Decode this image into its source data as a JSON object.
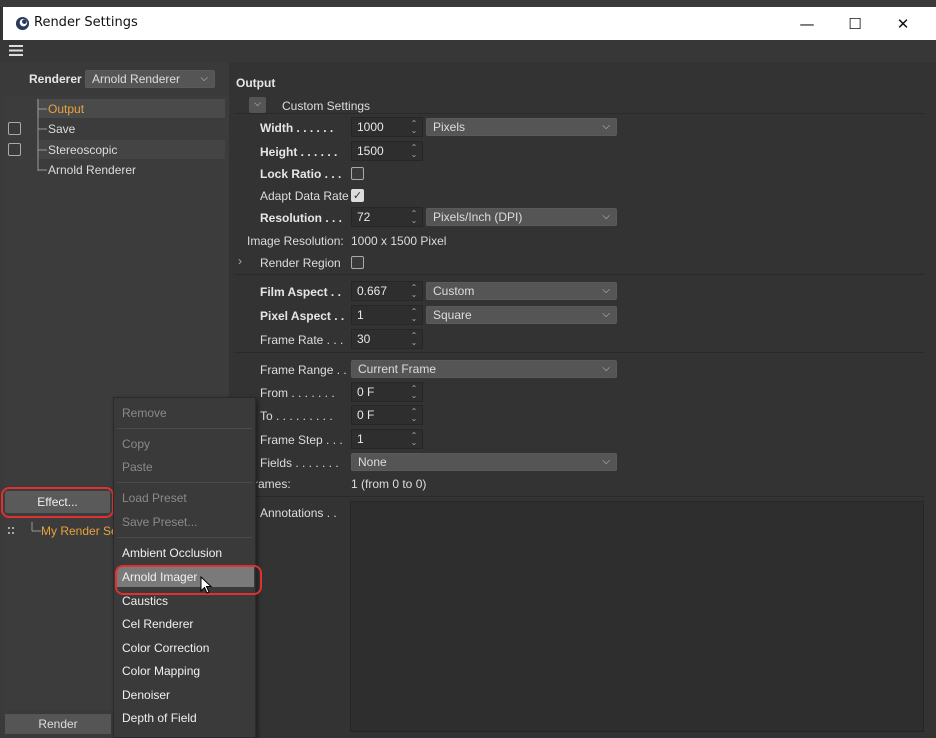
{
  "window": {
    "title": "Render Settings",
    "minimize": "—",
    "maximize": "☐",
    "close": "✕"
  },
  "left": {
    "renderer_label": "Renderer",
    "renderer_value": "Arnold Renderer",
    "tree": [
      "Output",
      "Save",
      "Stereoscopic",
      "Arnold Renderer"
    ],
    "effect_button": "Effect...",
    "my_render_setting": "My Render Se",
    "render_button": "Render"
  },
  "output": {
    "heading": "Output",
    "custom_settings": "Custom Settings",
    "width_label": "Width . . . . . .",
    "width_value": "1000",
    "width_unit": "Pixels",
    "height_label": "Height . . . . . .",
    "height_value": "1500",
    "lock_ratio_label": "Lock Ratio . . .",
    "adapt_label": "Adapt Data Rate",
    "resolution_label": "Resolution . . .",
    "resolution_value": "72",
    "resolution_unit": "Pixels/Inch (DPI)",
    "image_res_label": "Image Resolution:",
    "image_res_value": "1000 x 1500 Pixel",
    "render_region_label": "Render Region",
    "film_aspect_label": "Film Aspect . .",
    "film_aspect_value": "0.667",
    "film_aspect_preset": "Custom",
    "pixel_aspect_label": "Pixel Aspect . .",
    "pixel_aspect_value": "1",
    "pixel_aspect_preset": "Square",
    "frame_rate_label": "Frame Rate . . .",
    "frame_rate_value": "30",
    "frame_range_label": "Frame Range . .",
    "frame_range_value": "Current Frame",
    "from_label": "From . . . . . . .",
    "from_value": "0 F",
    "to_label": "To . . . . . . . . .",
    "to_value": "0 F",
    "frame_step_label": "Frame Step . . .",
    "frame_step_value": "1",
    "fields_label": "Fields . . . . . . .",
    "fields_value": "None",
    "frames_label": "rames:",
    "frames_value": "1 (from 0 to 0)",
    "annotations_label": "Annotations . ."
  },
  "menu": {
    "remove": "Remove",
    "copy": "Copy",
    "paste": "Paste",
    "load_preset": "Load Preset",
    "save_preset": "Save Preset...",
    "items": [
      "Ambient Occlusion",
      "Arnold Imager",
      "Caustics",
      "Cel Renderer",
      "Color Correction",
      "Color Mapping",
      "Denoiser",
      "Depth of Field"
    ]
  },
  "colors": {
    "accent_orange": "#e8a33c",
    "highlight": "#e03030"
  }
}
